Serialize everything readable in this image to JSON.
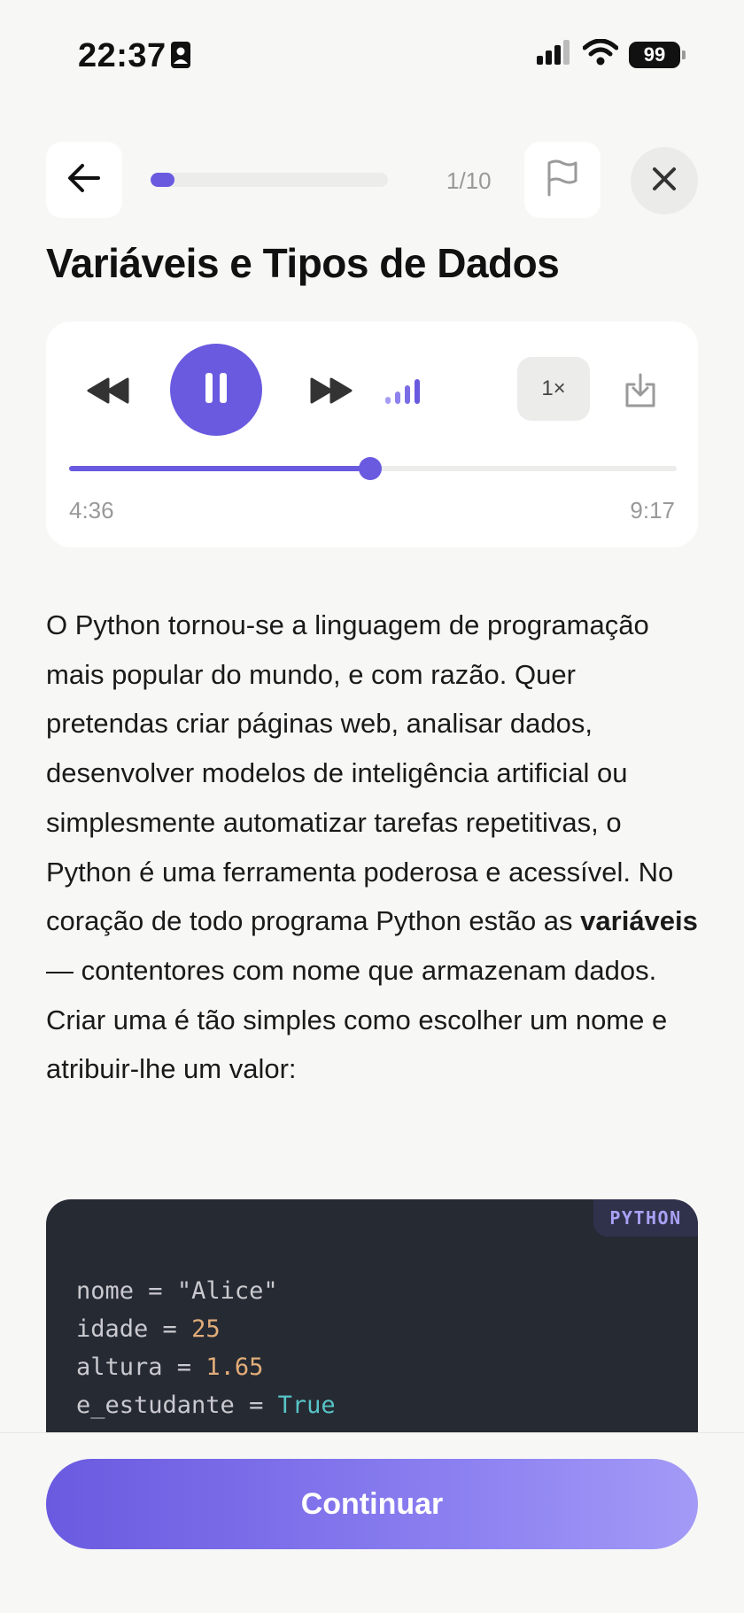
{
  "status_bar": {
    "time": "22:37",
    "battery": "99"
  },
  "nav": {
    "progress_label": "1/10",
    "progress_fraction": 0.1
  },
  "lesson": {
    "title": "Variáveis e Tipos de Dados",
    "paragraph_before_bold": "O Python tornou-se a linguagem de programação mais popular do mundo, e com razão. Quer pretendas criar páginas web, analisar dados, desenvolver modelos de inteligência artificial ou simplesmente automatizar tarefas repetitivas, o Python é uma ferramenta poderosa e acessível. No coração de todo programa Python estão as ",
    "paragraph_bold": "variáveis",
    "paragraph_after_bold": " — contentores com nome que armazenam dados. Criar uma é tão simples como escolher um nome e atribuir-lhe um valor:"
  },
  "player": {
    "speed_label": "1×",
    "current_time": "4:36",
    "total_time": "9:17",
    "position_fraction": 0.496
  },
  "code": {
    "language": "PYTHON",
    "lines": [
      {
        "name": "nome",
        "op": " = ",
        "value": "\"Alice\"",
        "kind": "str"
      },
      {
        "name": "idade",
        "op": " = ",
        "value": "25",
        "kind": "num"
      },
      {
        "name": "altura",
        "op": " = ",
        "value": "1.65",
        "kind": "num"
      },
      {
        "name": "e_estudante",
        "op": " = ",
        "value": "True",
        "kind": "bool"
      }
    ]
  },
  "footer": {
    "continue_label": "Continuar"
  },
  "colors": {
    "accent": "#6a5ae0",
    "code_background": "#262a33"
  },
  "icons": {
    "back": "arrow-left-icon",
    "flag": "flag-icon",
    "close": "close-icon",
    "rewind": "rewind-icon",
    "pause": "pause-icon",
    "forward": "fast-forward-icon",
    "volume": "volume-bars-icon",
    "download": "download-icon"
  }
}
